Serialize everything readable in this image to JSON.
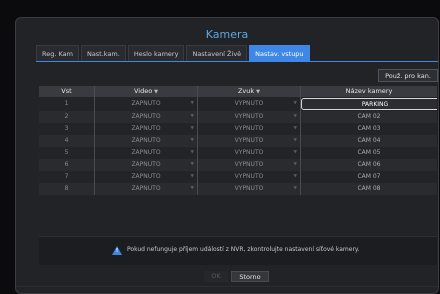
{
  "title": "Kamera",
  "tabs": [
    "Reg. Kam",
    "Nast.kam.",
    "Heslo kamery",
    "Nastavení Živě",
    "Nastav. vstupu"
  ],
  "active_tab": 4,
  "copy_button": "Použ. pro kan.",
  "table": {
    "headers": {
      "vst": "Vst",
      "video": "Video",
      "zvuk": "Zvuk",
      "nazev": "Název kamery"
    },
    "rows": [
      {
        "vst": "1",
        "video": "ZAPNUTO",
        "zvuk": "VYPNUTO",
        "name": "PARKING"
      },
      {
        "vst": "2",
        "video": "ZAPNUTO",
        "zvuk": "VYPNUTO",
        "name": "CAM 02"
      },
      {
        "vst": "3",
        "video": "ZAPNUTO",
        "zvuk": "VYPNUTO",
        "name": "CAM 03"
      },
      {
        "vst": "4",
        "video": "ZAPNUTO",
        "zvuk": "VYPNUTO",
        "name": "CAM 04"
      },
      {
        "vst": "5",
        "video": "ZAPNUTO",
        "zvuk": "VYPNUTO",
        "name": "CAM 05"
      },
      {
        "vst": "6",
        "video": "ZAPNUTO",
        "zvuk": "VYPNUTO",
        "name": "CAM 06"
      },
      {
        "vst": "7",
        "video": "ZAPNUTO",
        "zvuk": "VYPNUTO",
        "name": "CAM 07"
      },
      {
        "vst": "8",
        "video": "ZAPNUTO",
        "zvuk": "VYPNUTO",
        "name": "CAM 08"
      }
    ]
  },
  "notice": "Pokud nefunguje příjem událostí z NVR, zkontrolujte nastavení síťové kamery.",
  "buttons": {
    "ok": "OK",
    "cancel": "Storno"
  },
  "colors": {
    "accent": "#3f87e4",
    "title": "#5aa8e0",
    "background": "#222327"
  },
  "icons": {
    "warning": "warning-icon",
    "dropdown": "chevron-down-icon"
  }
}
